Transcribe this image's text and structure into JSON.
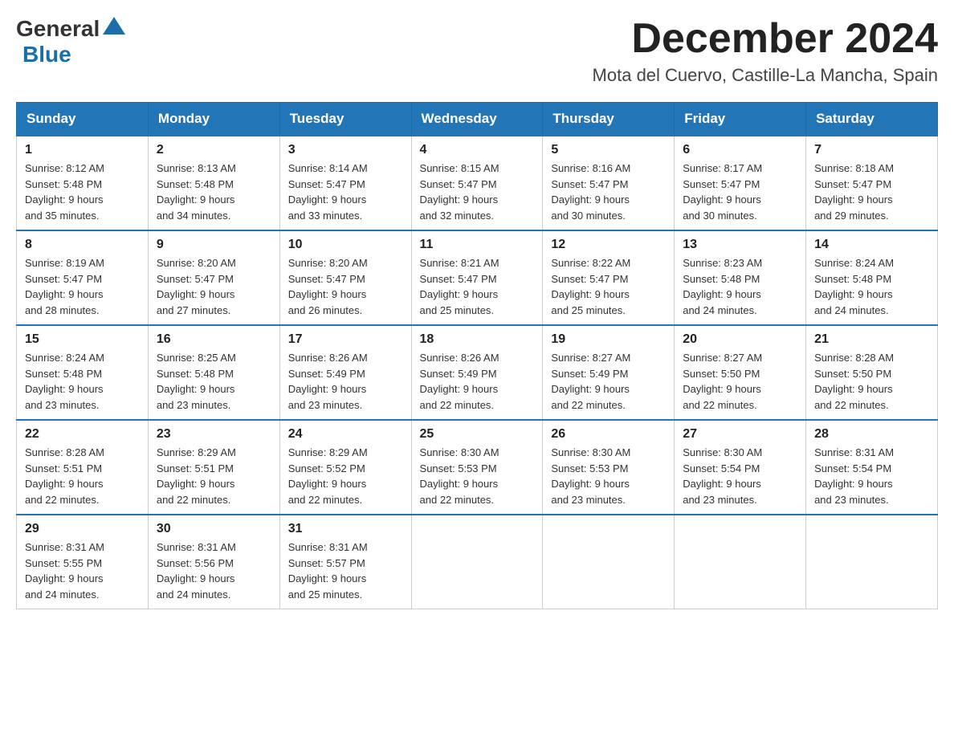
{
  "header": {
    "logo_general": "General",
    "logo_blue": "Blue",
    "month_title": "December 2024",
    "location": "Mota del Cuervo, Castille-La Mancha, Spain"
  },
  "weekdays": [
    "Sunday",
    "Monday",
    "Tuesday",
    "Wednesday",
    "Thursday",
    "Friday",
    "Saturday"
  ],
  "weeks": [
    [
      {
        "day": "1",
        "sunrise": "8:12 AM",
        "sunset": "5:48 PM",
        "daylight": "9 hours and 35 minutes."
      },
      {
        "day": "2",
        "sunrise": "8:13 AM",
        "sunset": "5:48 PM",
        "daylight": "9 hours and 34 minutes."
      },
      {
        "day": "3",
        "sunrise": "8:14 AM",
        "sunset": "5:47 PM",
        "daylight": "9 hours and 33 minutes."
      },
      {
        "day": "4",
        "sunrise": "8:15 AM",
        "sunset": "5:47 PM",
        "daylight": "9 hours and 32 minutes."
      },
      {
        "day": "5",
        "sunrise": "8:16 AM",
        "sunset": "5:47 PM",
        "daylight": "9 hours and 30 minutes."
      },
      {
        "day": "6",
        "sunrise": "8:17 AM",
        "sunset": "5:47 PM",
        "daylight": "9 hours and 30 minutes."
      },
      {
        "day": "7",
        "sunrise": "8:18 AM",
        "sunset": "5:47 PM",
        "daylight": "9 hours and 29 minutes."
      }
    ],
    [
      {
        "day": "8",
        "sunrise": "8:19 AM",
        "sunset": "5:47 PM",
        "daylight": "9 hours and 28 minutes."
      },
      {
        "day": "9",
        "sunrise": "8:20 AM",
        "sunset": "5:47 PM",
        "daylight": "9 hours and 27 minutes."
      },
      {
        "day": "10",
        "sunrise": "8:20 AM",
        "sunset": "5:47 PM",
        "daylight": "9 hours and 26 minutes."
      },
      {
        "day": "11",
        "sunrise": "8:21 AM",
        "sunset": "5:47 PM",
        "daylight": "9 hours and 25 minutes."
      },
      {
        "day": "12",
        "sunrise": "8:22 AM",
        "sunset": "5:47 PM",
        "daylight": "9 hours and 25 minutes."
      },
      {
        "day": "13",
        "sunrise": "8:23 AM",
        "sunset": "5:48 PM",
        "daylight": "9 hours and 24 minutes."
      },
      {
        "day": "14",
        "sunrise": "8:24 AM",
        "sunset": "5:48 PM",
        "daylight": "9 hours and 24 minutes."
      }
    ],
    [
      {
        "day": "15",
        "sunrise": "8:24 AM",
        "sunset": "5:48 PM",
        "daylight": "9 hours and 23 minutes."
      },
      {
        "day": "16",
        "sunrise": "8:25 AM",
        "sunset": "5:48 PM",
        "daylight": "9 hours and 23 minutes."
      },
      {
        "day": "17",
        "sunrise": "8:26 AM",
        "sunset": "5:49 PM",
        "daylight": "9 hours and 23 minutes."
      },
      {
        "day": "18",
        "sunrise": "8:26 AM",
        "sunset": "5:49 PM",
        "daylight": "9 hours and 22 minutes."
      },
      {
        "day": "19",
        "sunrise": "8:27 AM",
        "sunset": "5:49 PM",
        "daylight": "9 hours and 22 minutes."
      },
      {
        "day": "20",
        "sunrise": "8:27 AM",
        "sunset": "5:50 PM",
        "daylight": "9 hours and 22 minutes."
      },
      {
        "day": "21",
        "sunrise": "8:28 AM",
        "sunset": "5:50 PM",
        "daylight": "9 hours and 22 minutes."
      }
    ],
    [
      {
        "day": "22",
        "sunrise": "8:28 AM",
        "sunset": "5:51 PM",
        "daylight": "9 hours and 22 minutes."
      },
      {
        "day": "23",
        "sunrise": "8:29 AM",
        "sunset": "5:51 PM",
        "daylight": "9 hours and 22 minutes."
      },
      {
        "day": "24",
        "sunrise": "8:29 AM",
        "sunset": "5:52 PM",
        "daylight": "9 hours and 22 minutes."
      },
      {
        "day": "25",
        "sunrise": "8:30 AM",
        "sunset": "5:53 PM",
        "daylight": "9 hours and 22 minutes."
      },
      {
        "day": "26",
        "sunrise": "8:30 AM",
        "sunset": "5:53 PM",
        "daylight": "9 hours and 23 minutes."
      },
      {
        "day": "27",
        "sunrise": "8:30 AM",
        "sunset": "5:54 PM",
        "daylight": "9 hours and 23 minutes."
      },
      {
        "day": "28",
        "sunrise": "8:31 AM",
        "sunset": "5:54 PM",
        "daylight": "9 hours and 23 minutes."
      }
    ],
    [
      {
        "day": "29",
        "sunrise": "8:31 AM",
        "sunset": "5:55 PM",
        "daylight": "9 hours and 24 minutes."
      },
      {
        "day": "30",
        "sunrise": "8:31 AM",
        "sunset": "5:56 PM",
        "daylight": "9 hours and 24 minutes."
      },
      {
        "day": "31",
        "sunrise": "8:31 AM",
        "sunset": "5:57 PM",
        "daylight": "9 hours and 25 minutes."
      },
      null,
      null,
      null,
      null
    ]
  ],
  "labels": {
    "sunrise": "Sunrise:",
    "sunset": "Sunset:",
    "daylight": "Daylight:"
  }
}
